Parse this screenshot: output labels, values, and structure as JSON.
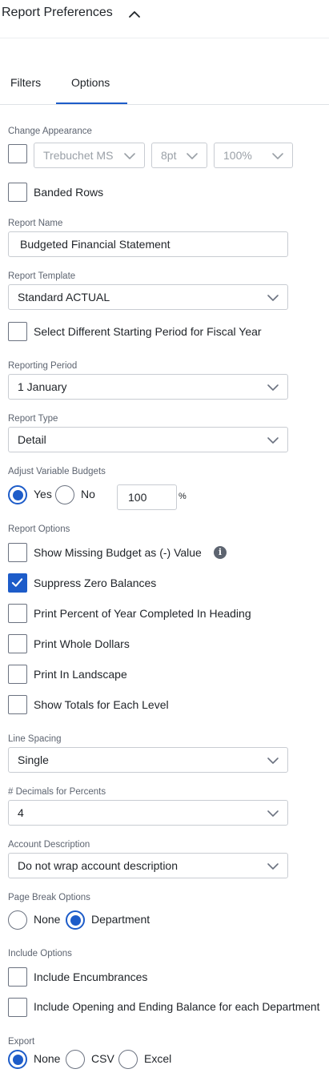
{
  "header": {
    "title": "Report Preferences"
  },
  "tabs": [
    {
      "label": "Filters"
    },
    {
      "label": "Options"
    }
  ],
  "appearance": {
    "label": "Change Appearance",
    "font": "Trebuchet MS",
    "size": "8pt",
    "zoom": "100%",
    "enabled": false
  },
  "banded_rows": {
    "label": "Banded Rows",
    "checked": false
  },
  "report_name": {
    "label": "Report Name",
    "value": "Budgeted Financial Statement"
  },
  "report_template": {
    "label": "Report Template",
    "value": "Standard ACTUAL"
  },
  "starting_period": {
    "label": "Select Different Starting Period for Fiscal Year",
    "checked": false
  },
  "reporting_period": {
    "label": "Reporting Period",
    "value": "1 January"
  },
  "report_type": {
    "label": "Report Type",
    "value": "Detail"
  },
  "adjust_budgets": {
    "label": "Adjust Variable Budgets",
    "yes": "Yes",
    "no": "No",
    "selected": "Yes",
    "percent_value": "100",
    "percent_sign": "%"
  },
  "report_options": {
    "label": "Report Options",
    "items": [
      {
        "label": "Show Missing Budget as (-) Value",
        "checked": false,
        "info_icon": "i"
      },
      {
        "label": "Suppress Zero Balances",
        "checked": true
      },
      {
        "label": "Print Percent of Year Completed In Heading",
        "checked": false
      },
      {
        "label": "Print Whole Dollars",
        "checked": false
      },
      {
        "label": "Print In Landscape",
        "checked": false
      },
      {
        "label": "Show Totals for Each Level",
        "checked": false
      }
    ]
  },
  "line_spacing": {
    "label": "Line Spacing",
    "value": "Single"
  },
  "decimals_percents": {
    "label": "# Decimals for Percents",
    "value": "4"
  },
  "account_description": {
    "label": "Account Description",
    "value": "Do not wrap account description"
  },
  "page_break": {
    "label": "Page Break Options",
    "none": "None",
    "department": "Department",
    "selected": "Department"
  },
  "include_options": {
    "label": "Include Options",
    "items": [
      {
        "label": "Include Encumbrances",
        "checked": false
      },
      {
        "label": "Include Opening and Ending Balance for each Department",
        "checked": false
      }
    ]
  },
  "export": {
    "label": "Export",
    "none": "None",
    "csv": "CSV",
    "excel": "Excel",
    "selected": "None"
  },
  "colors": {
    "accent": "#1d5cc9",
    "border": "#c8ccd2",
    "label_text": "#5d6470",
    "divider": "#dfe2e6"
  }
}
